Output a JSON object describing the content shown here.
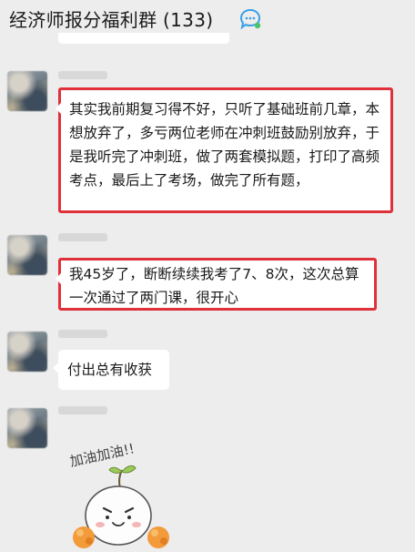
{
  "header": {
    "title": "经济师报分福利群 (133)",
    "group_icon": "group-chat-icon"
  },
  "messages": [
    {
      "text": "其实我前期复习得不好，只听了基础班前几章，本想放弃了，多亏两位老师在冲刺班鼓励别放弃，于是我听完了冲刺班，做了两套模拟题，打印了高频考点，最后上了考场，做完了所有题，",
      "highlighted": true
    },
    {
      "text": "我45岁了，断断续续我考了7、8次，这次总算一次通过了两门课，很开心",
      "highlighted": true
    },
    {
      "text": "付出总有收获",
      "highlighted": false
    }
  ],
  "sticker": {
    "caption": "加油加油!!",
    "icon": "cheering-sprout-sticker"
  },
  "colors": {
    "background": "#ededed",
    "bubble": "#ffffff",
    "highlight": "#e0303a",
    "group_icon": "#3aa0e8"
  }
}
